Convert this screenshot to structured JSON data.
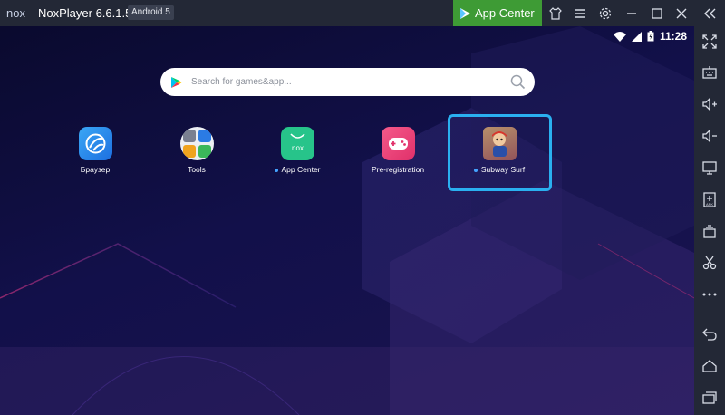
{
  "titlebar": {
    "logo": "nox",
    "title": "NoxPlayer 6.6.1.5",
    "android_badge": "Android 5",
    "app_center_label": "App Center"
  },
  "status_bar": {
    "time": "11:28"
  },
  "search": {
    "placeholder": "Search for games&app..."
  },
  "apps": [
    {
      "label": "Браузер",
      "new_dot": false
    },
    {
      "label": "Tools",
      "new_dot": false
    },
    {
      "label": "App Center",
      "new_dot": true
    },
    {
      "label": "Pre-registration",
      "new_dot": false
    },
    {
      "label": "Subway Surf",
      "new_dot": true,
      "selected": true
    }
  ],
  "colors": {
    "titlebar_bg": "#232836",
    "app_center_green": "#3e9b35",
    "selection_blue": "#2ab0f0"
  },
  "icons": {
    "titlebar": [
      "play-store-icon",
      "theme-icon",
      "menu-icon",
      "settings-icon",
      "minimize-icon",
      "maximize-icon",
      "close-icon",
      "collapse-sidebar-icon"
    ],
    "sidebar": [
      "fullscreen-icon",
      "keyboard-icon",
      "volume-up-icon",
      "volume-down-icon",
      "screen-icon",
      "apk-install-icon",
      "multi-instance-icon",
      "screenshot-icon",
      "more-icon",
      "back-icon",
      "home-icon",
      "recent-apps-icon"
    ]
  }
}
